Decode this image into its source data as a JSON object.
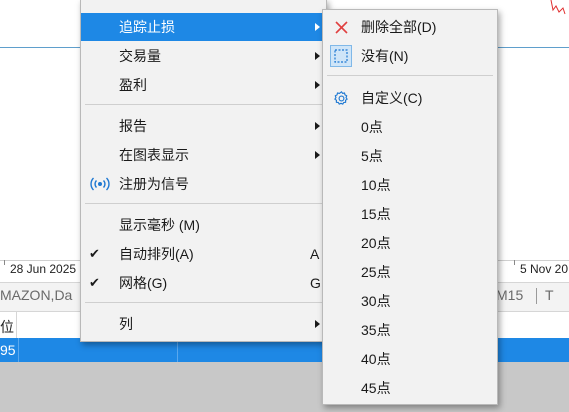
{
  "background": {
    "axis_labels": [
      "28 Jun 2025",
      "5 Nov 20"
    ],
    "tabs": [
      "MAZON,Da",
      "M15",
      "T"
    ],
    "table_header_first": "位",
    "table_row_first": "95"
  },
  "main_menu": {
    "items": [
      {
        "label": "追踪止损",
        "submenu": true,
        "highlighted": true
      },
      {
        "label": "交易量",
        "submenu": true
      },
      {
        "label": "盈利",
        "submenu": true
      },
      {
        "label": "报告",
        "submenu": true
      },
      {
        "label": "在图表显示",
        "submenu": true
      },
      {
        "label": "注册为信号",
        "icon": "signal-icon"
      },
      {
        "label": "显示毫秒 (M)"
      },
      {
        "label": "自动排列(A)",
        "checked": true,
        "shortcut": "A"
      },
      {
        "label": "网格(G)",
        "checked": true,
        "shortcut": "G"
      },
      {
        "label": "列",
        "submenu": true
      }
    ],
    "check_mark": "✔"
  },
  "sub_menu": {
    "items": [
      {
        "label": "删除全部(D)",
        "icon": "close-icon"
      },
      {
        "label": "没有(N)",
        "icon": "dotted-square-icon",
        "selected": true
      },
      {
        "label": "自定义(C)",
        "icon": "gear-icon"
      },
      {
        "label": "0点"
      },
      {
        "label": "5点"
      },
      {
        "label": "10点"
      },
      {
        "label": "15点"
      },
      {
        "label": "20点"
      },
      {
        "label": "25点"
      },
      {
        "label": "30点"
      },
      {
        "label": "35点"
      },
      {
        "label": "40点"
      },
      {
        "label": "45点"
      }
    ]
  },
  "colors": {
    "highlight": "#1e88e5",
    "close_icon": "#e04040",
    "gear_icon": "#1e78d2"
  }
}
